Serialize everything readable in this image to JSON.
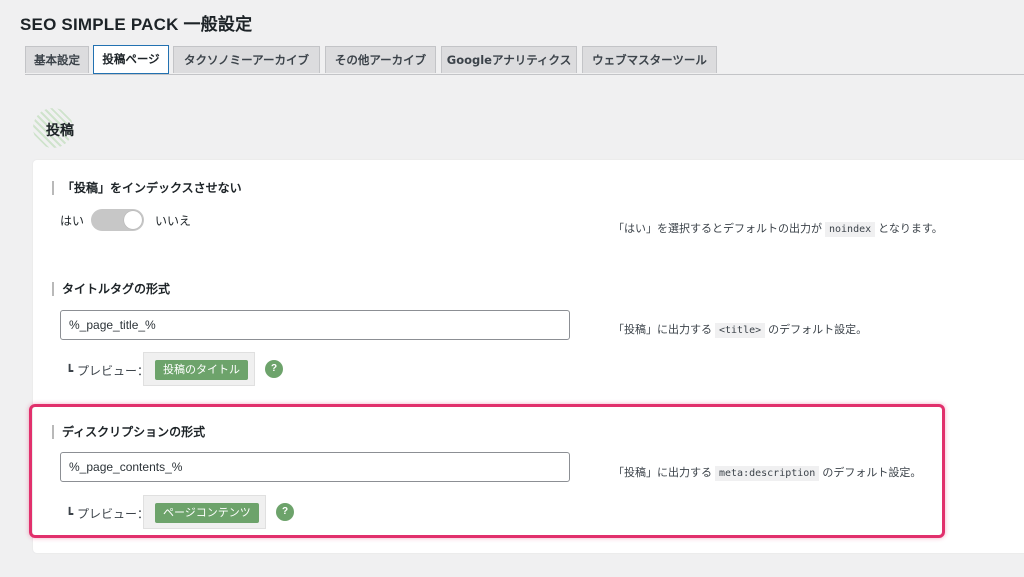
{
  "page": {
    "title": "SEO SIMPLE PACK 一般設定"
  },
  "tabs": [
    {
      "label": "基本設定"
    },
    {
      "label": "投稿ページ"
    },
    {
      "label": "タクソノミーアーカイブ"
    },
    {
      "label": "その他アーカイブ"
    },
    {
      "label": "Googleアナリティクス"
    },
    {
      "label": "ウェブマスターツール"
    }
  ],
  "active_tab": "投稿ページ",
  "section": {
    "title": "投稿"
  },
  "noindex": {
    "label": "「投稿」をインデックスさせない",
    "yes": "はい",
    "no": "いいえ",
    "value": "いいえ",
    "desc_before": "「はい」を選択するとデフォルトの出力が",
    "desc_code": "noindex",
    "desc_after": "となります。"
  },
  "title_format": {
    "label": "タイトルタグの形式",
    "value": "%_page_title_%",
    "preview_label": "┗ プレビュー：",
    "preview_value": "投稿のタイトル",
    "help": "?",
    "desc_before": "「投稿」に出力する",
    "desc_code": "<title>",
    "desc_after": "のデフォルト設定。"
  },
  "description_format": {
    "label": "ディスクリプションの形式",
    "value": "%_page_contents_%",
    "preview_label": "┗ プレビュー：",
    "preview_value": "ページコンテンツ",
    "help": "?",
    "desc_before": "「投稿」に出力する",
    "desc_code": "meta:description",
    "desc_after": "のデフォルト設定。"
  },
  "colors": {
    "accent_green": "#6da36b",
    "highlight": "#e1306c",
    "active_tab_border": "#2271b1"
  }
}
